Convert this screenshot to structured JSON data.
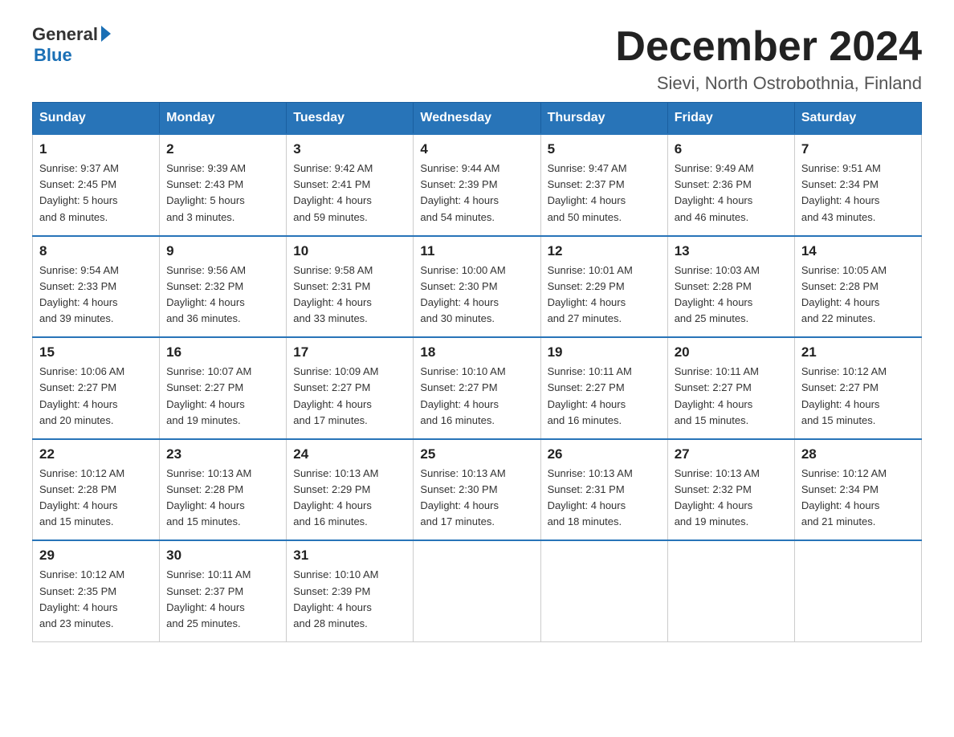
{
  "header": {
    "logo_general": "General",
    "logo_blue": "Blue",
    "month_title": "December 2024",
    "subtitle": "Sievi, North Ostrobothnia, Finland"
  },
  "weekdays": [
    "Sunday",
    "Monday",
    "Tuesday",
    "Wednesday",
    "Thursday",
    "Friday",
    "Saturday"
  ],
  "weeks": [
    [
      {
        "day": "1",
        "sunrise": "9:37 AM",
        "sunset": "2:45 PM",
        "daylight": "5 hours and 8 minutes."
      },
      {
        "day": "2",
        "sunrise": "9:39 AM",
        "sunset": "2:43 PM",
        "daylight": "5 hours and 3 minutes."
      },
      {
        "day": "3",
        "sunrise": "9:42 AM",
        "sunset": "2:41 PM",
        "daylight": "4 hours and 59 minutes."
      },
      {
        "day": "4",
        "sunrise": "9:44 AM",
        "sunset": "2:39 PM",
        "daylight": "4 hours and 54 minutes."
      },
      {
        "day": "5",
        "sunrise": "9:47 AM",
        "sunset": "2:37 PM",
        "daylight": "4 hours and 50 minutes."
      },
      {
        "day": "6",
        "sunrise": "9:49 AM",
        "sunset": "2:36 PM",
        "daylight": "4 hours and 46 minutes."
      },
      {
        "day": "7",
        "sunrise": "9:51 AM",
        "sunset": "2:34 PM",
        "daylight": "4 hours and 43 minutes."
      }
    ],
    [
      {
        "day": "8",
        "sunrise": "9:54 AM",
        "sunset": "2:33 PM",
        "daylight": "4 hours and 39 minutes."
      },
      {
        "day": "9",
        "sunrise": "9:56 AM",
        "sunset": "2:32 PM",
        "daylight": "4 hours and 36 minutes."
      },
      {
        "day": "10",
        "sunrise": "9:58 AM",
        "sunset": "2:31 PM",
        "daylight": "4 hours and 33 minutes."
      },
      {
        "day": "11",
        "sunrise": "10:00 AM",
        "sunset": "2:30 PM",
        "daylight": "4 hours and 30 minutes."
      },
      {
        "day": "12",
        "sunrise": "10:01 AM",
        "sunset": "2:29 PM",
        "daylight": "4 hours and 27 minutes."
      },
      {
        "day": "13",
        "sunrise": "10:03 AM",
        "sunset": "2:28 PM",
        "daylight": "4 hours and 25 minutes."
      },
      {
        "day": "14",
        "sunrise": "10:05 AM",
        "sunset": "2:28 PM",
        "daylight": "4 hours and 22 minutes."
      }
    ],
    [
      {
        "day": "15",
        "sunrise": "10:06 AM",
        "sunset": "2:27 PM",
        "daylight": "4 hours and 20 minutes."
      },
      {
        "day": "16",
        "sunrise": "10:07 AM",
        "sunset": "2:27 PM",
        "daylight": "4 hours and 19 minutes."
      },
      {
        "day": "17",
        "sunrise": "10:09 AM",
        "sunset": "2:27 PM",
        "daylight": "4 hours and 17 minutes."
      },
      {
        "day": "18",
        "sunrise": "10:10 AM",
        "sunset": "2:27 PM",
        "daylight": "4 hours and 16 minutes."
      },
      {
        "day": "19",
        "sunrise": "10:11 AM",
        "sunset": "2:27 PM",
        "daylight": "4 hours and 16 minutes."
      },
      {
        "day": "20",
        "sunrise": "10:11 AM",
        "sunset": "2:27 PM",
        "daylight": "4 hours and 15 minutes."
      },
      {
        "day": "21",
        "sunrise": "10:12 AM",
        "sunset": "2:27 PM",
        "daylight": "4 hours and 15 minutes."
      }
    ],
    [
      {
        "day": "22",
        "sunrise": "10:12 AM",
        "sunset": "2:28 PM",
        "daylight": "4 hours and 15 minutes."
      },
      {
        "day": "23",
        "sunrise": "10:13 AM",
        "sunset": "2:28 PM",
        "daylight": "4 hours and 15 minutes."
      },
      {
        "day": "24",
        "sunrise": "10:13 AM",
        "sunset": "2:29 PM",
        "daylight": "4 hours and 16 minutes."
      },
      {
        "day": "25",
        "sunrise": "10:13 AM",
        "sunset": "2:30 PM",
        "daylight": "4 hours and 17 minutes."
      },
      {
        "day": "26",
        "sunrise": "10:13 AM",
        "sunset": "2:31 PM",
        "daylight": "4 hours and 18 minutes."
      },
      {
        "day": "27",
        "sunrise": "10:13 AM",
        "sunset": "2:32 PM",
        "daylight": "4 hours and 19 minutes."
      },
      {
        "day": "28",
        "sunrise": "10:12 AM",
        "sunset": "2:34 PM",
        "daylight": "4 hours and 21 minutes."
      }
    ],
    [
      {
        "day": "29",
        "sunrise": "10:12 AM",
        "sunset": "2:35 PM",
        "daylight": "4 hours and 23 minutes."
      },
      {
        "day": "30",
        "sunrise": "10:11 AM",
        "sunset": "2:37 PM",
        "daylight": "4 hours and 25 minutes."
      },
      {
        "day": "31",
        "sunrise": "10:10 AM",
        "sunset": "2:39 PM",
        "daylight": "4 hours and 28 minutes."
      },
      null,
      null,
      null,
      null
    ]
  ],
  "labels": {
    "sunrise": "Sunrise:",
    "sunset": "Sunset:",
    "daylight": "Daylight:"
  }
}
